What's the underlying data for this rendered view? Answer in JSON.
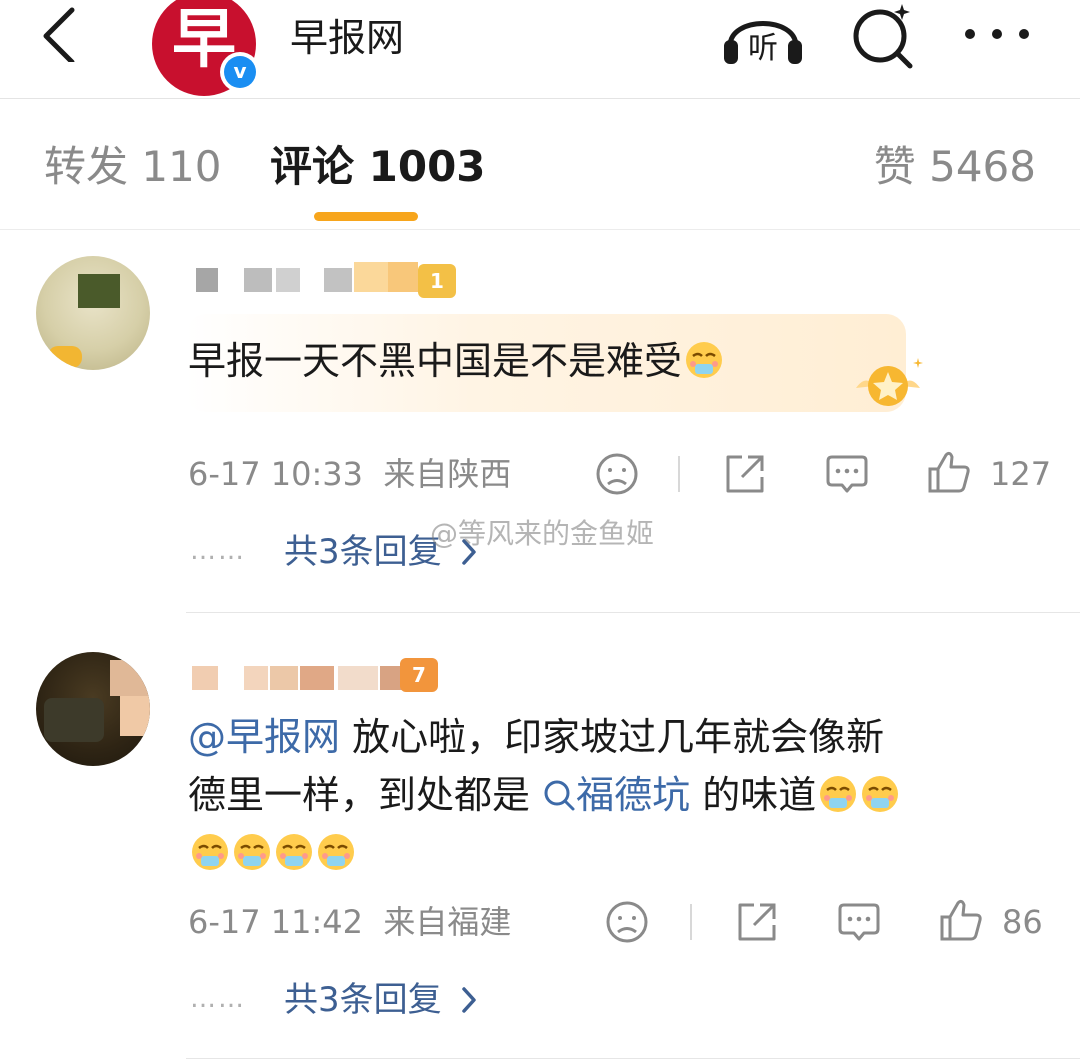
{
  "header": {
    "account_name": "早报网",
    "logo_char": "早",
    "verified_mark": "v",
    "listen_label": "听"
  },
  "tabs": {
    "repost": "转发 110",
    "comments": "评论 1003",
    "likes": "赞 5468"
  },
  "comments": [
    {
      "level": "1",
      "text": "早报一天不黑中国是不是难受",
      "emoji_count": 1,
      "time": "6-17 10:33",
      "location": "来自陕西",
      "likes": "127",
      "replies": "共3条回复",
      "replies_dots": "……"
    },
    {
      "level": "7",
      "mention": "@早报网",
      "text_part1": " 放心啦，印家坡过几年就会像新",
      "text_part2": "德里一样，到处都是",
      "topic": "福德坑",
      "text_part3": " 的味道",
      "time": "6-17 11:42",
      "location": "来自福建",
      "likes": "86",
      "replies": "共3条回复",
      "replies_dots": "……"
    }
  ],
  "watermark": "@等风来的金鱼姬",
  "icons": [
    "back-icon",
    "listen-icon",
    "search-icon",
    "more-icon",
    "dislike-icon",
    "share-icon",
    "comment-icon",
    "like-icon",
    "reply-chevron-icon",
    "emoji-icon",
    "topic-search-icon"
  ],
  "colors": {
    "accent": "#f7a51c",
    "link": "#3d6aa8",
    "brand": "#c8102e",
    "verified": "#1a8ef2"
  }
}
